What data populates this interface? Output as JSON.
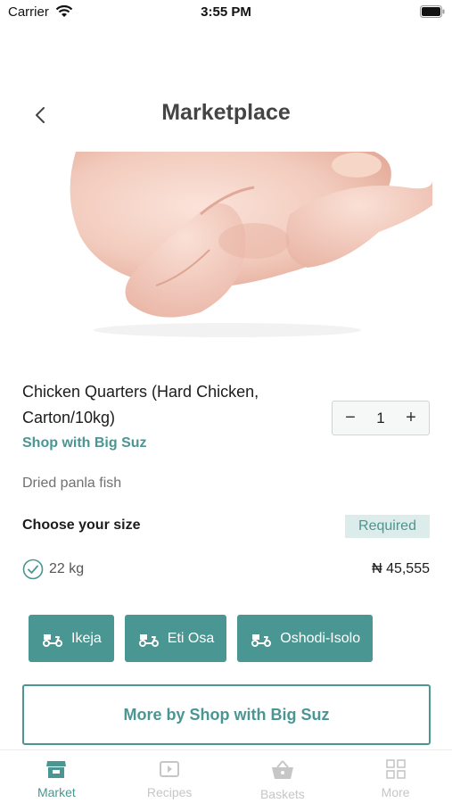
{
  "status_bar": {
    "carrier": "Carrier",
    "time": "3:55 PM"
  },
  "header": {
    "title": "Marketplace",
    "back_icon": "chevron-left-icon"
  },
  "product": {
    "image": "raw-chicken-photo",
    "name": "Chicken Quarters (Hard Chicken, Carton/10kg)",
    "shop": "Shop with Big Suz",
    "description": "Dried panla fish",
    "quantity": "1",
    "minus": "−",
    "plus": "+"
  },
  "size": {
    "label": "Choose your size",
    "required": "Required",
    "options": [
      {
        "weight": "22 kg",
        "price": "₦ 45,555",
        "selected": true
      }
    ]
  },
  "locations": [
    {
      "label": "Ikeja",
      "icon": "delivery-scooter-icon"
    },
    {
      "label": "Eti Osa",
      "icon": "delivery-scooter-icon"
    },
    {
      "label": "Oshodi-Isolo",
      "icon": "delivery-scooter-icon"
    }
  ],
  "more_button": "More by Shop with Big Suz",
  "tabs": [
    {
      "label": "Market",
      "icon": "store-icon",
      "active": true
    },
    {
      "label": "Recipes",
      "icon": "video-icon",
      "active": false
    },
    {
      "label": "Baskets",
      "icon": "basket-icon",
      "active": false
    },
    {
      "label": "More",
      "icon": "grid-icon",
      "active": false
    }
  ],
  "colors": {
    "accent": "#4a9693",
    "badge_bg": "#dcecea",
    "inactive": "#c6c6c6"
  }
}
